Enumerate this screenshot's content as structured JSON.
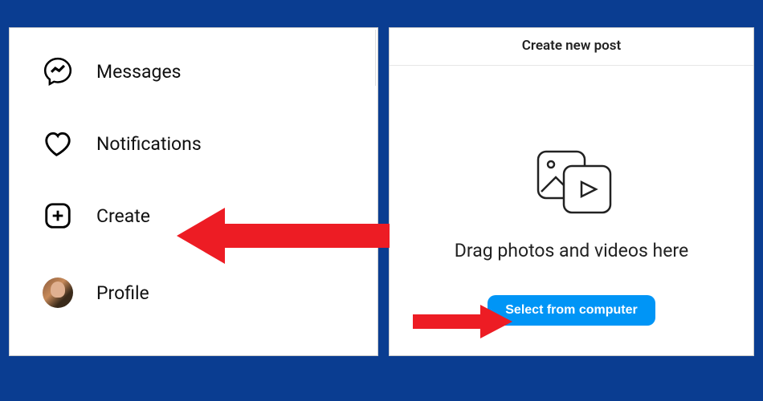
{
  "sidebar": {
    "items": [
      {
        "label": "Messages",
        "icon": "messenger-icon"
      },
      {
        "label": "Notifications",
        "icon": "heart-icon"
      },
      {
        "label": "Create",
        "icon": "plus-square-icon"
      },
      {
        "label": "Profile",
        "icon": "avatar"
      }
    ]
  },
  "create_modal": {
    "title": "Create new post",
    "drop_hint": "Drag photos and videos here",
    "select_button": "Select from computer"
  },
  "annotations": {
    "arrow1_target": "create",
    "arrow2_target": "select-button",
    "color": "#ed1c24"
  }
}
